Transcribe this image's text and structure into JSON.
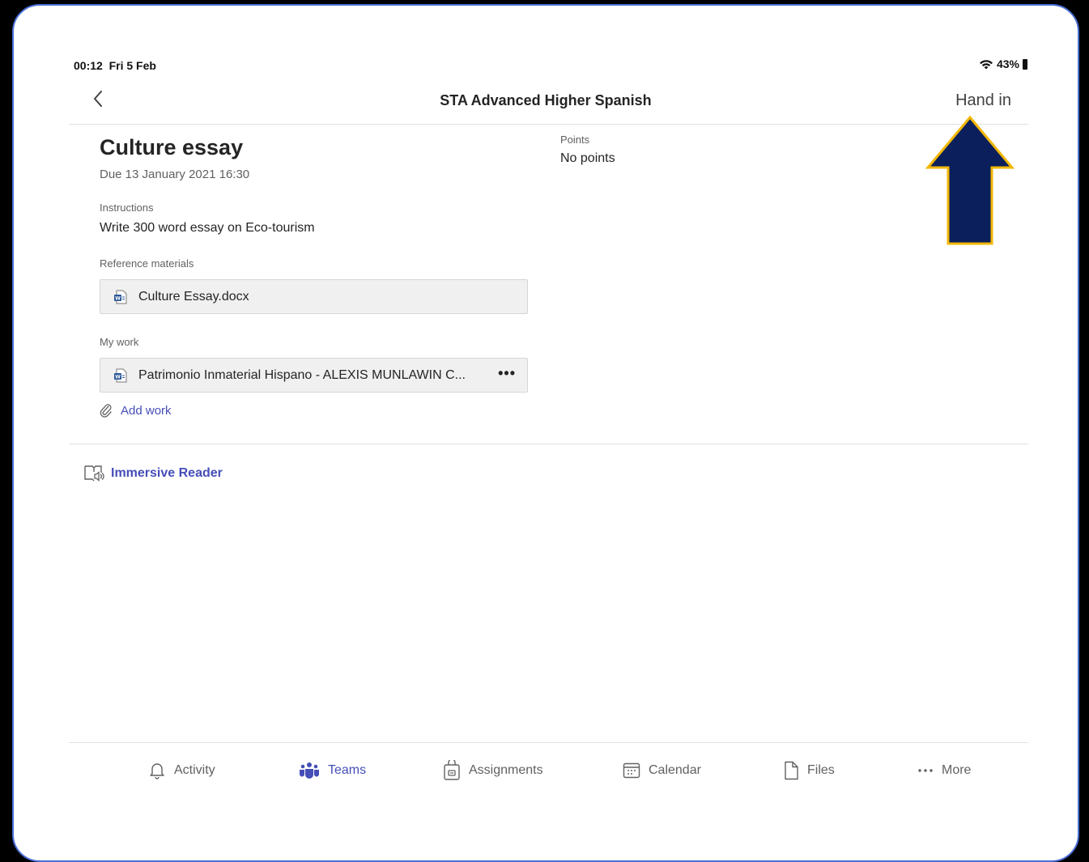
{
  "status_bar": {
    "time": "00:12",
    "date": "Fri 5 Feb",
    "battery": "43%"
  },
  "nav": {
    "title": "STA Advanced Higher Spanish",
    "hand_in_label": "Hand in"
  },
  "assignment": {
    "title": "Culture essay",
    "due": "Due 13 January 2021 16:30",
    "instructions_label": "Instructions",
    "instructions_text": "Write 300 word essay on Eco-tourism",
    "reference_label": "Reference materials",
    "reference_file": "Culture Essay.docx",
    "my_work_label": "My work",
    "my_work_file": "Patrimonio Inmaterial Hispano - ALEXIS MUNLAWIN C...",
    "more_dots": "•••",
    "add_work_label": "Add work",
    "points_label": "Points",
    "points_value": "No points",
    "immersive_reader_label": "Immersive Reader"
  },
  "tabs": [
    {
      "label": "Activity",
      "icon": "bell-icon",
      "active": false
    },
    {
      "label": "Teams",
      "icon": "teams-icon",
      "active": true
    },
    {
      "label": "Assignments",
      "icon": "assignments-icon",
      "active": false
    },
    {
      "label": "Calendar",
      "icon": "calendar-icon",
      "active": false
    },
    {
      "label": "Files",
      "icon": "file-icon",
      "active": false
    },
    {
      "label": "More",
      "icon": "more-icon",
      "active": false
    }
  ],
  "colors": {
    "accent": "#464eb8",
    "arrow_fill": "#0a1f5c",
    "arrow_stroke": "#f2b705",
    "frame_border": "#4a6fd6"
  }
}
